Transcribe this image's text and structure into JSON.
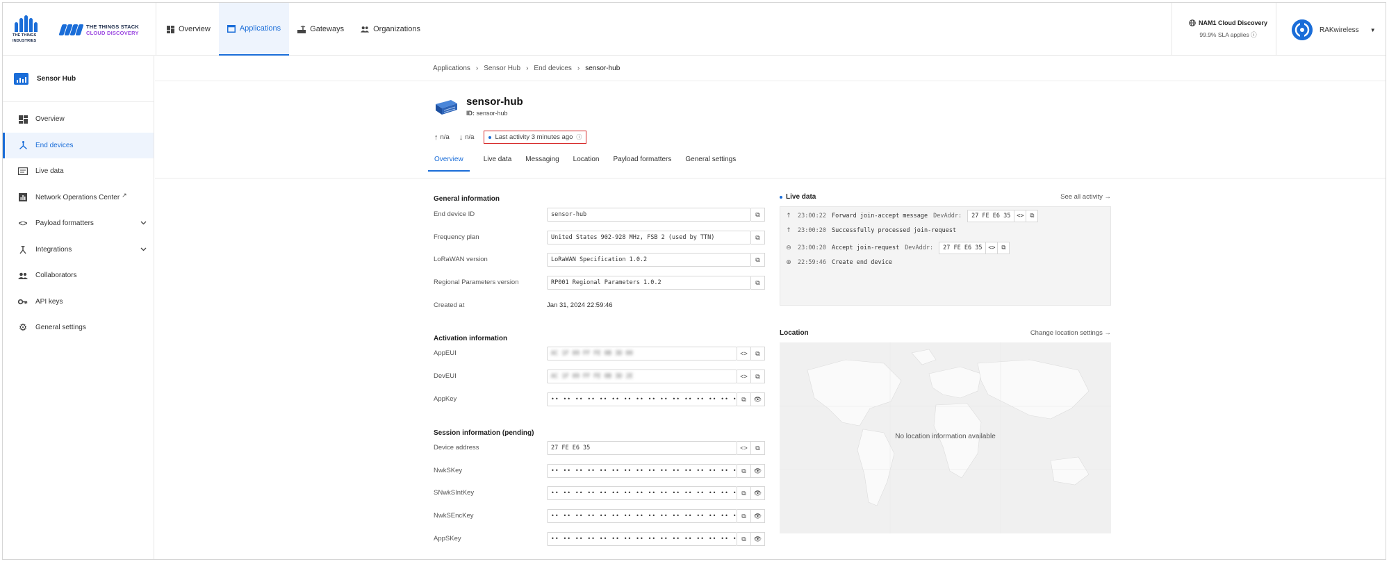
{
  "header": {
    "tti_logo_text": [
      "THE THINGS",
      "INDUSTRIES"
    ],
    "tts_logo_line1": "THE THINGS STACK",
    "tts_logo_line2": "CLOUD DISCOVERY",
    "nav": [
      {
        "label": "Overview",
        "icon": "overview-icon"
      },
      {
        "label": "Applications",
        "icon": "applications-icon",
        "active": true
      },
      {
        "label": "Gateways",
        "icon": "gateway-icon"
      },
      {
        "label": "Organizations",
        "icon": "organizations-icon"
      }
    ],
    "cloud_region": "NAM1 Cloud Discovery",
    "sla": "99.9% SLA applies",
    "user_name": "RAKwireless"
  },
  "sidebar": {
    "app_name": "Sensor Hub",
    "items": [
      {
        "label": "Overview",
        "icon": "dashboard-icon"
      },
      {
        "label": "End devices",
        "icon": "devices-icon",
        "active": true
      },
      {
        "label": "Live data",
        "icon": "live-data-icon"
      },
      {
        "label": "Network Operations Center",
        "icon": "noc-icon",
        "external": true
      },
      {
        "label": "Payload formatters",
        "icon": "code-icon",
        "expandable": true
      },
      {
        "label": "Integrations",
        "icon": "integrations-icon",
        "expandable": true
      },
      {
        "label": "Collaborators",
        "icon": "people-icon"
      },
      {
        "label": "API keys",
        "icon": "key-icon"
      },
      {
        "label": "General settings",
        "icon": "gear-icon"
      }
    ]
  },
  "breadcrumb": [
    "Applications",
    "Sensor Hub",
    "End devices",
    "sensor-hub"
  ],
  "device": {
    "name": "sensor-hub",
    "id_label": "ID:",
    "id_value": "sensor-hub",
    "uplink": "n/a",
    "downlink": "n/a",
    "last_activity": "Last activity 3 minutes ago"
  },
  "tabs": [
    "Overview",
    "Live data",
    "Messaging",
    "Location",
    "Payload formatters",
    "General settings"
  ],
  "general": {
    "title": "General information",
    "end_device_id_label": "End device ID",
    "end_device_id": "sensor-hub",
    "frequency_plan_label": "Frequency plan",
    "frequency_plan": "United States 902-928 MHz, FSB 2 (used by TTN)",
    "lorawan_version_label": "LoRaWAN version",
    "lorawan_version": "LoRaWAN Specification 1.0.2",
    "regional_label": "Regional Parameters version",
    "regional": "RP001 Regional Parameters 1.0.2",
    "created_label": "Created at",
    "created": "Jan 31, 2024 22:59:46"
  },
  "activation": {
    "title": "Activation information",
    "appeui_label": "AppEUI",
    "appeui": "AC 1F 09 FF FE 0B 3D 00",
    "deveui_label": "DevEUI",
    "deveui": "AC 1F 09 FF FE 0B 3D 2E",
    "appkey_label": "AppKey",
    "appkey": "•• •• •• •• •• •• •• •• •• •• •• •• •• •• •• ••"
  },
  "session": {
    "title": "Session information (pending)",
    "devaddr_label": "Device address",
    "devaddr": "27 FE E6 35",
    "nwkskey_label": "NwkSKey",
    "snwk_label": "SNwkSIntKey",
    "nwkenc_label": "NwkSEncKey",
    "appskey_label": "AppSKey",
    "masked": "•• •• •• •• •• •• •• •• •• •• •• •• •• •• •• ••"
  },
  "live": {
    "title": "Live data",
    "see_all": "See all activity →",
    "rows": [
      {
        "icon": "uplink-arrow-icon",
        "time": "23:00:22",
        "text": "Forward join-accept message",
        "addr_label": "DevAddr:",
        "addr": "27 FE E6 35"
      },
      {
        "icon": "uplink-arrow-icon",
        "time": "23:00:20",
        "text": "Successfully processed join-request"
      },
      {
        "icon": "link-icon",
        "time": "23:00:20",
        "text": "Accept join-request",
        "addr_label": "DevAddr:",
        "addr": "27 FE E6 35"
      },
      {
        "icon": "add-circle-icon",
        "time": "22:59:46",
        "text": "Create end device"
      }
    ]
  },
  "location": {
    "title": "Location",
    "change": "Change location settings →",
    "empty": "No location information available"
  },
  "colors": {
    "accent": "#1a6dd8",
    "highlight_border": "#d62828",
    "brand_purple": "#9a46e0"
  }
}
